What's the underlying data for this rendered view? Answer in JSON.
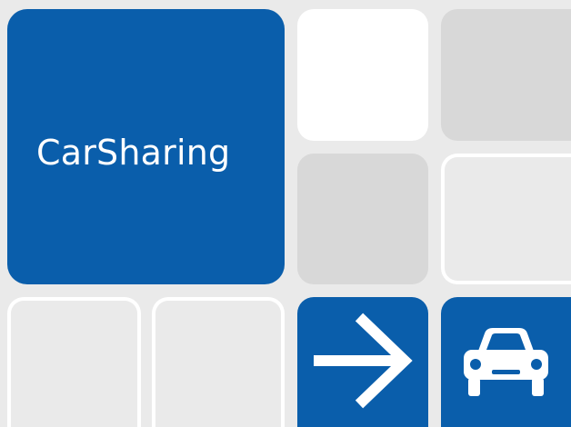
{
  "brand": {
    "title": "CarSharing"
  },
  "icons": {
    "arrow": "arrow-right-icon",
    "car": "car-icon"
  },
  "colors": {
    "blue": "#0a5eab",
    "background": "#eaeaea",
    "tile_gray": "#d8d8d8",
    "tile_white": "#ffffff"
  }
}
